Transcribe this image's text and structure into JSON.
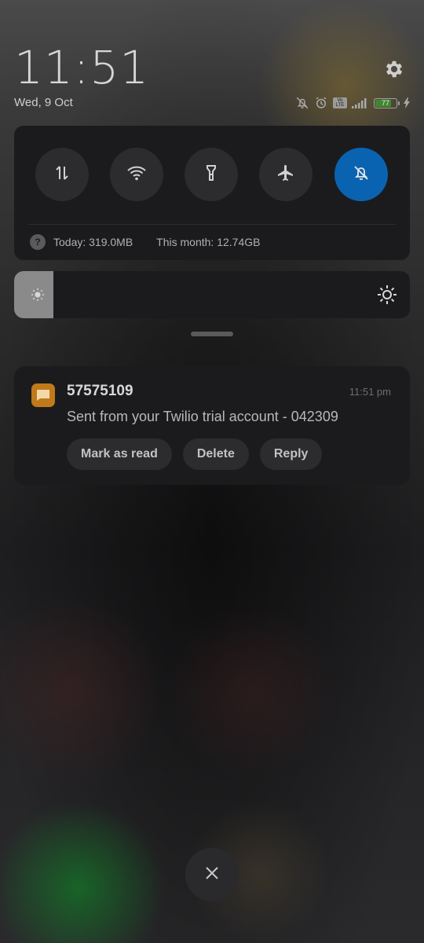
{
  "status_bar": {
    "time": "11:51",
    "date": "Wed, 9 Oct",
    "battery_level": "77",
    "battery_fraction": 0.77,
    "icons": [
      "bell-off-icon",
      "alarm-icon",
      "volte-icon",
      "signal-icon",
      "battery-icon",
      "charging-icon"
    ],
    "lte_label": "Vo LTE"
  },
  "settings": {
    "icon": "gear-icon"
  },
  "quick_settings": {
    "toggles": [
      {
        "name": "mobile-data",
        "icon": "data-arrows-icon",
        "active": false
      },
      {
        "name": "wifi",
        "icon": "wifi-icon",
        "active": false
      },
      {
        "name": "flashlight",
        "icon": "flashlight-icon",
        "active": false
      },
      {
        "name": "airplane-mode",
        "icon": "airplane-icon",
        "active": false
      },
      {
        "name": "silent-mode",
        "icon": "bell-off-icon",
        "active": true
      }
    ],
    "data_today": "Today: 319.0MB",
    "data_month": "This month: 12.74GB",
    "active_color": "#0a63b0"
  },
  "brightness": {
    "level": 0.1
  },
  "notification": {
    "app_icon": "message-icon",
    "app_color": "#c07a1a",
    "title": "57575109",
    "time": "11:51 pm",
    "body": "Sent from your Twilio trial account - 042309",
    "actions": [
      "Mark as read",
      "Delete",
      "Reply"
    ]
  },
  "close_icon": "close-icon"
}
